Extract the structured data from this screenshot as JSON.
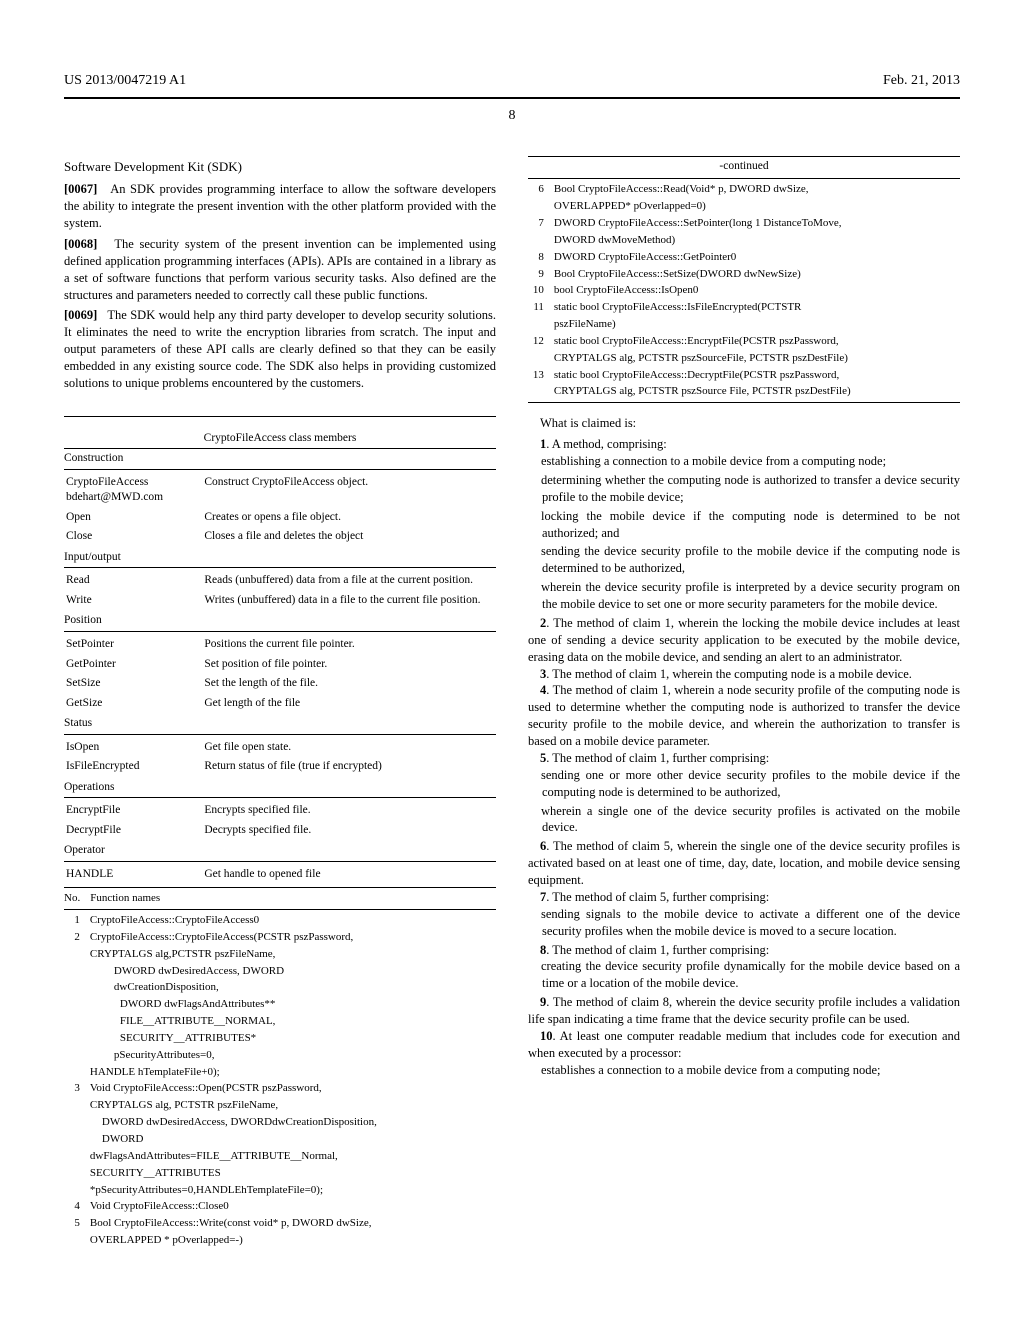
{
  "header": {
    "pub_number": "US 2013/0047219 A1",
    "date": "Feb. 21, 2013",
    "page": "8"
  },
  "left": {
    "sdk_title": "Software Development Kit (SDK)",
    "p67": "An SDK provides programming interface to allow the software developers the ability to integrate the present invention with the other platform provided with the system.",
    "p68": "The security system of the present invention can be implemented using defined application programming interfaces (APIs). APIs are contained in a library as a set of software functions that perform various security tasks. Also defined are the structures and parameters needed to correctly call these public functions.",
    "p69": "The SDK would help any third party developer to develop security solutions. It eliminates the need to write the encryption libraries from scratch. The input and output parameters of these API calls are clearly defined so that they can be easily embedded in any existing source code. The SDK also helps in providing customized solutions to unique problems encountered by the customers.",
    "members_title": "CryptoFileAccess class members",
    "construction": "Construction",
    "members_construction": [
      {
        "l": "CryptoFileAccess bdehart@MWD.com",
        "r": "Construct CryptoFileAccess object."
      },
      {
        "l": "Open",
        "r": "Creates or opens a file object."
      },
      {
        "l": "Close",
        "r": "Closes a file and deletes the object"
      }
    ],
    "io": "Input/output",
    "members_io": [
      {
        "l": "Read",
        "r": "Reads (unbuffered) data from a file at the current position."
      },
      {
        "l": "Write",
        "r": "Writes (unbuffered) data in a file to the current file position."
      }
    ],
    "position": "Position",
    "members_position": [
      {
        "l": "SetPointer",
        "r": "Positions the current file pointer."
      },
      {
        "l": "GetPointer",
        "r": "Set position of file pointer."
      },
      {
        "l": "SetSize",
        "r": "Set the length of the file."
      },
      {
        "l": "GetSize",
        "r": "Get length of the file"
      }
    ],
    "status": "Status",
    "members_status": [
      {
        "l": "IsOpen",
        "r": "Get file open state."
      },
      {
        "l": "IsFileEncrypted",
        "r": "Return status of file (true if encrypted)"
      }
    ],
    "operations": "Operations",
    "members_ops": [
      {
        "l": "EncryptFile",
        "r": "Encrypts specified file."
      },
      {
        "l": "DecryptFile",
        "r": "Decrypts specified file."
      }
    ],
    "operator": "Operator",
    "members_operator": [
      {
        "l": "HANDLE",
        "r": "Get handle to opened file"
      }
    ],
    "fn_header_no": "No.",
    "fn_header_name": "Function names",
    "fns": [
      {
        "n": "1",
        "lines": [
          "CryptoFileAccess::CryptoFileAccess0"
        ]
      },
      {
        "n": "2",
        "lines": [
          "CryptoFileAccess::CryptoFileAccess(PCSTR pszPassword,",
          "CRYPTALGS alg,PCTSTR pszFileName,",
          "        DWORD dwDesiredAccess, DWORD",
          "        dwCreationDisposition,",
          "          DWORD dwFlagsAndAttributes**",
          "          FILE__ATTRIBUTE__NORMAL,",
          "          SECURITY__ATTRIBUTES*",
          "        pSecurityAttributes=0,",
          "HANDLE hTemplateFile+0);"
        ]
      },
      {
        "n": "3",
        "lines": [
          "Void CryptoFileAccess::Open(PCSTR pszPassword,",
          "CRYPTALGS alg, PCTSTR pszFileName,",
          "    DWORD dwDesiredAccess, DWORDdwCreationDisposition,",
          "    DWORD",
          "dwFlagsAndAttributes=FILE__ATTRIBUTE__Normal,",
          "SECURITY__ATTRIBUTES",
          "*pSecurityAttributes=0,HANDLEhTemplateFile=0);"
        ]
      },
      {
        "n": "4",
        "lines": [
          "Void CryptoFileAccess::Close0"
        ]
      },
      {
        "n": "5",
        "lines": [
          "Bool CryptoFileAccess::Write(const void* p, DWORD dwSize,",
          "OVERLAPPED * pOverlapped=-)"
        ]
      }
    ]
  },
  "right": {
    "continued": "-continued",
    "fns": [
      {
        "n": "6",
        "lines": [
          "Bool CryptoFileAccess::Read(Void* p, DWORD dwSize,",
          "OVERLAPPED* pOverlapped=0)"
        ]
      },
      {
        "n": "7",
        "lines": [
          "DWORD CryptoFileAccess::SetPointer(long 1 DistanceToMove,",
          "DWORD dwMoveMethod)"
        ]
      },
      {
        "n": "8",
        "lines": [
          "DWORD CryptoFileAccess::GetPointer0"
        ]
      },
      {
        "n": "9",
        "lines": [
          "Bool CryptoFileAccess::SetSize(DWORD dwNewSize)"
        ]
      },
      {
        "n": "10",
        "lines": [
          "bool CryptoFileAccess::IsOpen0"
        ]
      },
      {
        "n": "11",
        "lines": [
          "static bool CryptoFileAccess::IsFileEncrypted(PCTSTR",
          "pszFileName)"
        ]
      },
      {
        "n": "12",
        "lines": [
          "static bool CryptoFileAccess::EncryptFile(PCSTR pszPassword,",
          "CRYPTALGS alg, PCTSTR pszSourceFile, PCTSTR pszDestFile)"
        ]
      },
      {
        "n": "13",
        "lines": [
          "static bool CryptoFileAccess::DecryptFile(PCSTR pszPassword,",
          "CRYPTALGS alg, PCTSTR pszSource File, PCTSTR pszDestFile)"
        ]
      }
    ],
    "claims_intro": "What is claimed is:",
    "claims": [
      {
        "n": "1",
        "lead": "A method, comprising:",
        "steps": [
          "establishing a connection to a mobile device from a computing node;",
          "determining whether the computing node is authorized to transfer a device security profile to the mobile device;",
          "locking the mobile device if the computing node is determined to be not authorized; and",
          "sending the device security profile to the mobile device if the computing node is determined to be authorized,",
          "wherein the device security profile is interpreted by a device security program on the mobile device to set one or more security parameters for the mobile device."
        ]
      },
      {
        "n": "2",
        "body": "The method of claim 1, wherein the locking the mobile device includes at least one of sending a device security application to be executed by the mobile device, erasing data on the mobile device, and sending an alert to an administrator."
      },
      {
        "n": "3",
        "body": "The method of claim 1, wherein the computing node is a mobile device."
      },
      {
        "n": "4",
        "body": "The method of claim 1, wherein a node security profile of the computing node is used to determine whether the computing node is authorized to transfer the device security profile to the mobile device, and wherein the authorization to transfer is based on a mobile device parameter."
      },
      {
        "n": "5",
        "lead": "The method of claim 1, further comprising:",
        "steps": [
          "sending one or more other device security profiles to the mobile device if the computing node is determined to be authorized,",
          "wherein a single one of the device security profiles is activated on the mobile device."
        ]
      },
      {
        "n": "6",
        "body": "The method of claim 5, wherein the single one of the device security profiles is activated based on at least one of time, day, date, location, and mobile device sensing equipment."
      },
      {
        "n": "7",
        "lead": "The method of claim 5, further comprising:",
        "steps": [
          "sending signals to the mobile device to activate a different one of the device security profiles when the mobile device is moved to a secure location."
        ]
      },
      {
        "n": "8",
        "lead": "The method of claim 1, further comprising:",
        "steps": [
          "creating the device security profile dynamically for the mobile device based on a time or a location of the mobile device."
        ]
      },
      {
        "n": "9",
        "body": "The method of claim 8, wherein the device security profile includes a validation life span indicating a time frame that the device security profile can be used."
      },
      {
        "n": "10",
        "lead": "At least one computer readable medium that includes code for execution and when executed by a processor:",
        "steps": [
          "establishes a connection to a mobile device from a computing node;"
        ]
      }
    ]
  }
}
